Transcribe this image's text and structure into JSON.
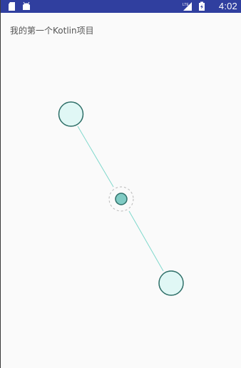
{
  "status_bar": {
    "time": "4:02",
    "network_label": "LTE",
    "left_icons": [
      "sd-card-icon",
      "android-icon"
    ],
    "color": "#303F9F"
  },
  "app": {
    "title": "我的第一个Kotlin项目"
  },
  "canvas": {
    "handle_fill": "#e0f7f5",
    "handle_stroke": "#2e6f68",
    "line_color": "#7fd8cc",
    "center_fill": "#80cbc4"
  }
}
